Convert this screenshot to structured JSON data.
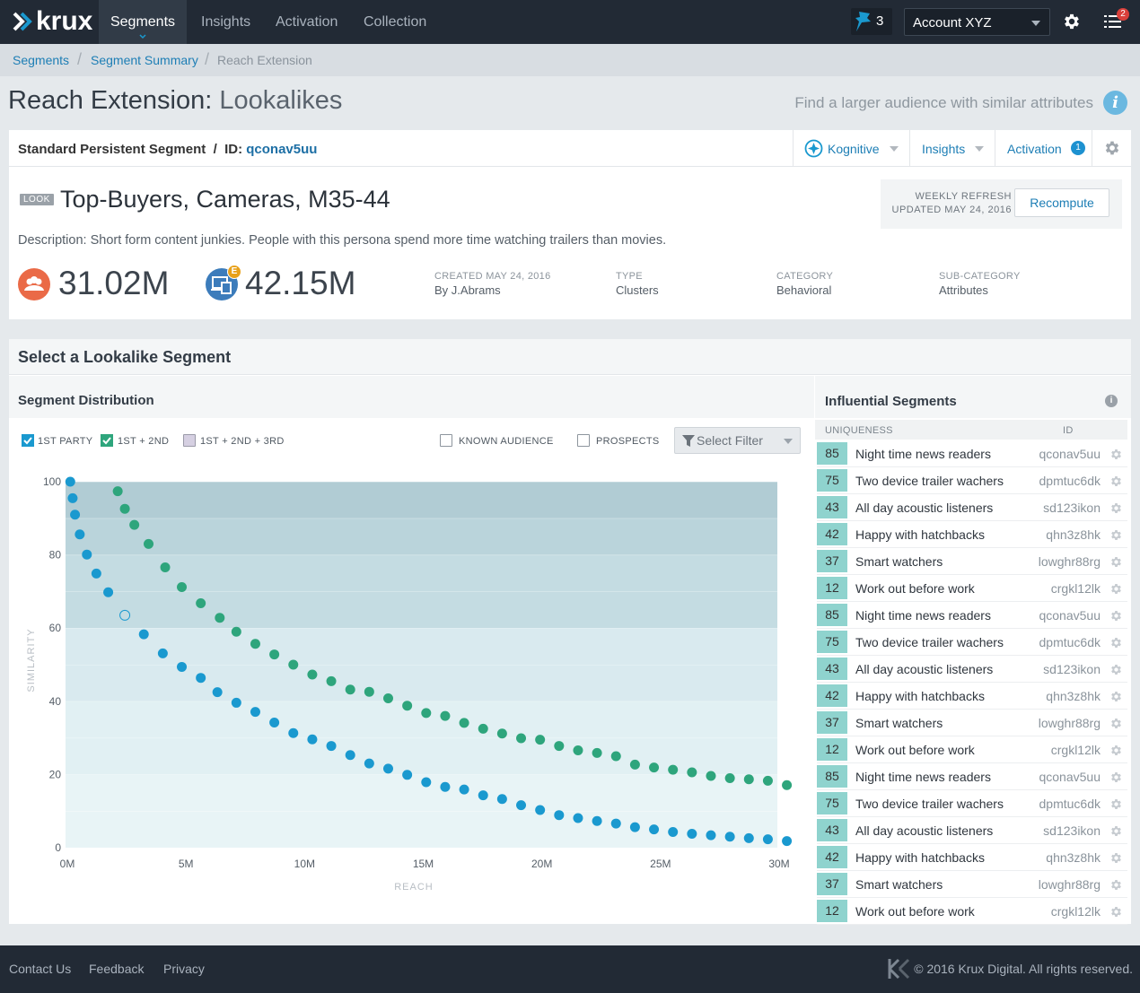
{
  "nav": {
    "logo": "krux",
    "tabs": [
      "Segments",
      "Insights",
      "Activation",
      "Collection"
    ],
    "pin_count": "3",
    "account": "Account XYZ",
    "notif_count": "2"
  },
  "breadcrumb": [
    "Segments",
    "Segment Summary",
    "Reach Extension"
  ],
  "page": {
    "title_bold": "Reach Extension:",
    "title_light": "Lookalikes",
    "hint": "Find a larger audience with similar attributes"
  },
  "segment": {
    "type_label": "Standard Persistent Segment",
    "id_label": "ID:",
    "id": "qconav5uu",
    "buttons": {
      "kognitive": "Kognitive",
      "insights": "Insights",
      "activation": "Activation",
      "activation_badge": "1"
    },
    "tag": "LOOK",
    "name": "Top-Buyers, Cameras, M35-44",
    "refresh_line1": "WEEKLY REFRESH",
    "refresh_line2": "UPDATED MAY 24, 2016",
    "recompute": "Recompute",
    "description": "Description: Short form content junkies. People with this persona spend more time watching trailers than movies.",
    "stat1": "31.02M",
    "stat2": "42.15M",
    "stat2_badge": "E",
    "meta": [
      {
        "label": "CREATED MAY 24, 2016",
        "value": "By J.Abrams"
      },
      {
        "label": "TYPE",
        "value": "Clusters"
      },
      {
        "label": "CATEGORY",
        "value": "Behavioral"
      },
      {
        "label": "SUB-CATEGORY",
        "value": "Attributes"
      }
    ]
  },
  "lookalike": {
    "title": "Select a Lookalike Segment",
    "distribution_title": "Segment Distribution",
    "checks": [
      "1ST PARTY",
      "1ST + 2ND",
      "1ST + 2ND + 3RD",
      "KNOWN AUDIENCE",
      "PROSPECTS"
    ],
    "filter_placeholder": "Select Filter"
  },
  "influential": {
    "title": "Influential Segments",
    "col_uniqueness": "UNIQUENESS",
    "col_id": "ID",
    "rows": [
      {
        "u": "85",
        "name": "Night time news readers",
        "id": "qconav5uu"
      },
      {
        "u": "75",
        "name": "Two device trailer wachers",
        "id": "dpmtuc6dk"
      },
      {
        "u": "43",
        "name": "All day acoustic listeners",
        "id": "sd123ikon"
      },
      {
        "u": "42",
        "name": "Happy with hatchbacks",
        "id": "qhn3z8hk"
      },
      {
        "u": "37",
        "name": "Smart watchers",
        "id": "lowghr88rg"
      },
      {
        "u": "12",
        "name": "Work out before work",
        "id": "crgkl12lk"
      },
      {
        "u": "85",
        "name": "Night time news readers",
        "id": "qconav5uu"
      },
      {
        "u": "75",
        "name": "Two device trailer wachers",
        "id": "dpmtuc6dk"
      },
      {
        "u": "43",
        "name": "All day acoustic listeners",
        "id": "sd123ikon"
      },
      {
        "u": "42",
        "name": "Happy with hatchbacks",
        "id": "qhn3z8hk"
      },
      {
        "u": "37",
        "name": "Smart watchers",
        "id": "lowghr88rg"
      },
      {
        "u": "12",
        "name": "Work out before work",
        "id": "crgkl12lk"
      },
      {
        "u": "85",
        "name": "Night time news readers",
        "id": "qconav5uu"
      },
      {
        "u": "75",
        "name": "Two device trailer wachers",
        "id": "dpmtuc6dk"
      },
      {
        "u": "43",
        "name": "All day acoustic listeners",
        "id": "sd123ikon"
      },
      {
        "u": "42",
        "name": "Happy with hatchbacks",
        "id": "qhn3z8hk"
      },
      {
        "u": "37",
        "name": "Smart watchers",
        "id": "lowghr88rg"
      },
      {
        "u": "12",
        "name": "Work out before work",
        "id": "crgkl12lk"
      }
    ]
  },
  "chart_data": {
    "type": "scatter",
    "xlabel": "REACH",
    "ylabel": "SIMILARITY",
    "xlim": [
      0,
      30
    ],
    "ylim": [
      0,
      100
    ],
    "x_ticks": [
      "0M",
      "5M",
      "10M",
      "15M",
      "20M",
      "25M",
      "30M"
    ],
    "y_ticks": [
      "0",
      "20",
      "40",
      "60",
      "80",
      "100"
    ],
    "series": [
      {
        "color": "#1a99cf",
        "x": [
          0.2,
          0.3,
          0.4,
          0.6,
          0.9,
          1.3,
          1.8,
          3.3,
          4.1,
          4.9,
          5.7,
          6.4,
          7.2,
          8.0,
          8.8,
          9.6,
          10.4,
          11.2,
          12.0,
          12.8,
          13.6,
          14.4,
          15.2,
          16.0,
          16.8,
          17.6,
          18.4,
          19.2,
          20.0,
          20.8,
          21.6,
          22.4,
          23.2,
          24.0,
          24.8,
          25.6,
          26.4,
          27.2,
          28.0,
          28.8,
          29.6,
          30.4
        ],
        "y": [
          100,
          95.5,
          91,
          85.6,
          80.1,
          74.9,
          69.8,
          58.3,
          53.1,
          49.4,
          46.4,
          42.5,
          39.6,
          37.1,
          34.2,
          31.3,
          29.6,
          27.8,
          25.3,
          23.0,
          21.6,
          19.9,
          17.9,
          16.6,
          15.9,
          14.3,
          13.3,
          11.6,
          10.3,
          8.9,
          8.1,
          7.3,
          6.6,
          5.6,
          5.0,
          4.3,
          3.8,
          3.4,
          3.0,
          2.6,
          2.3,
          1.8
        ]
      },
      {
        "color": "#1a99cf",
        "hollow": true,
        "x": [
          2.5
        ],
        "y": [
          63.5
        ]
      },
      {
        "color": "#2ea57c",
        "x": [
          2.2,
          2.5,
          2.9,
          3.5,
          4.2,
          4.9,
          5.7,
          6.5,
          7.2,
          8.0,
          8.8,
          9.6,
          10.4,
          11.2,
          12.0,
          12.8,
          13.6,
          14.4,
          15.2,
          16.0,
          16.8,
          17.6,
          18.4,
          19.2,
          20.0,
          20.8,
          21.6,
          22.4,
          23.2,
          24.0,
          24.8,
          25.6,
          26.4,
          27.2,
          28.0,
          28.8,
          29.6,
          30.4
        ],
        "y": [
          97.4,
          92.6,
          88.2,
          83.0,
          76.6,
          71.2,
          66.8,
          62.8,
          59.0,
          55.7,
          52.8,
          50.0,
          47.3,
          45.5,
          43.2,
          42.6,
          40.8,
          38.8,
          36.8,
          36.0,
          34.1,
          32.5,
          31.2,
          29.9,
          29.5,
          27.8,
          26.6,
          25.9,
          25.0,
          22.7,
          21.9,
          21.3,
          20.6,
          19.6,
          19.0,
          18.7,
          18.3,
          17.1
        ]
      }
    ]
  }
}
